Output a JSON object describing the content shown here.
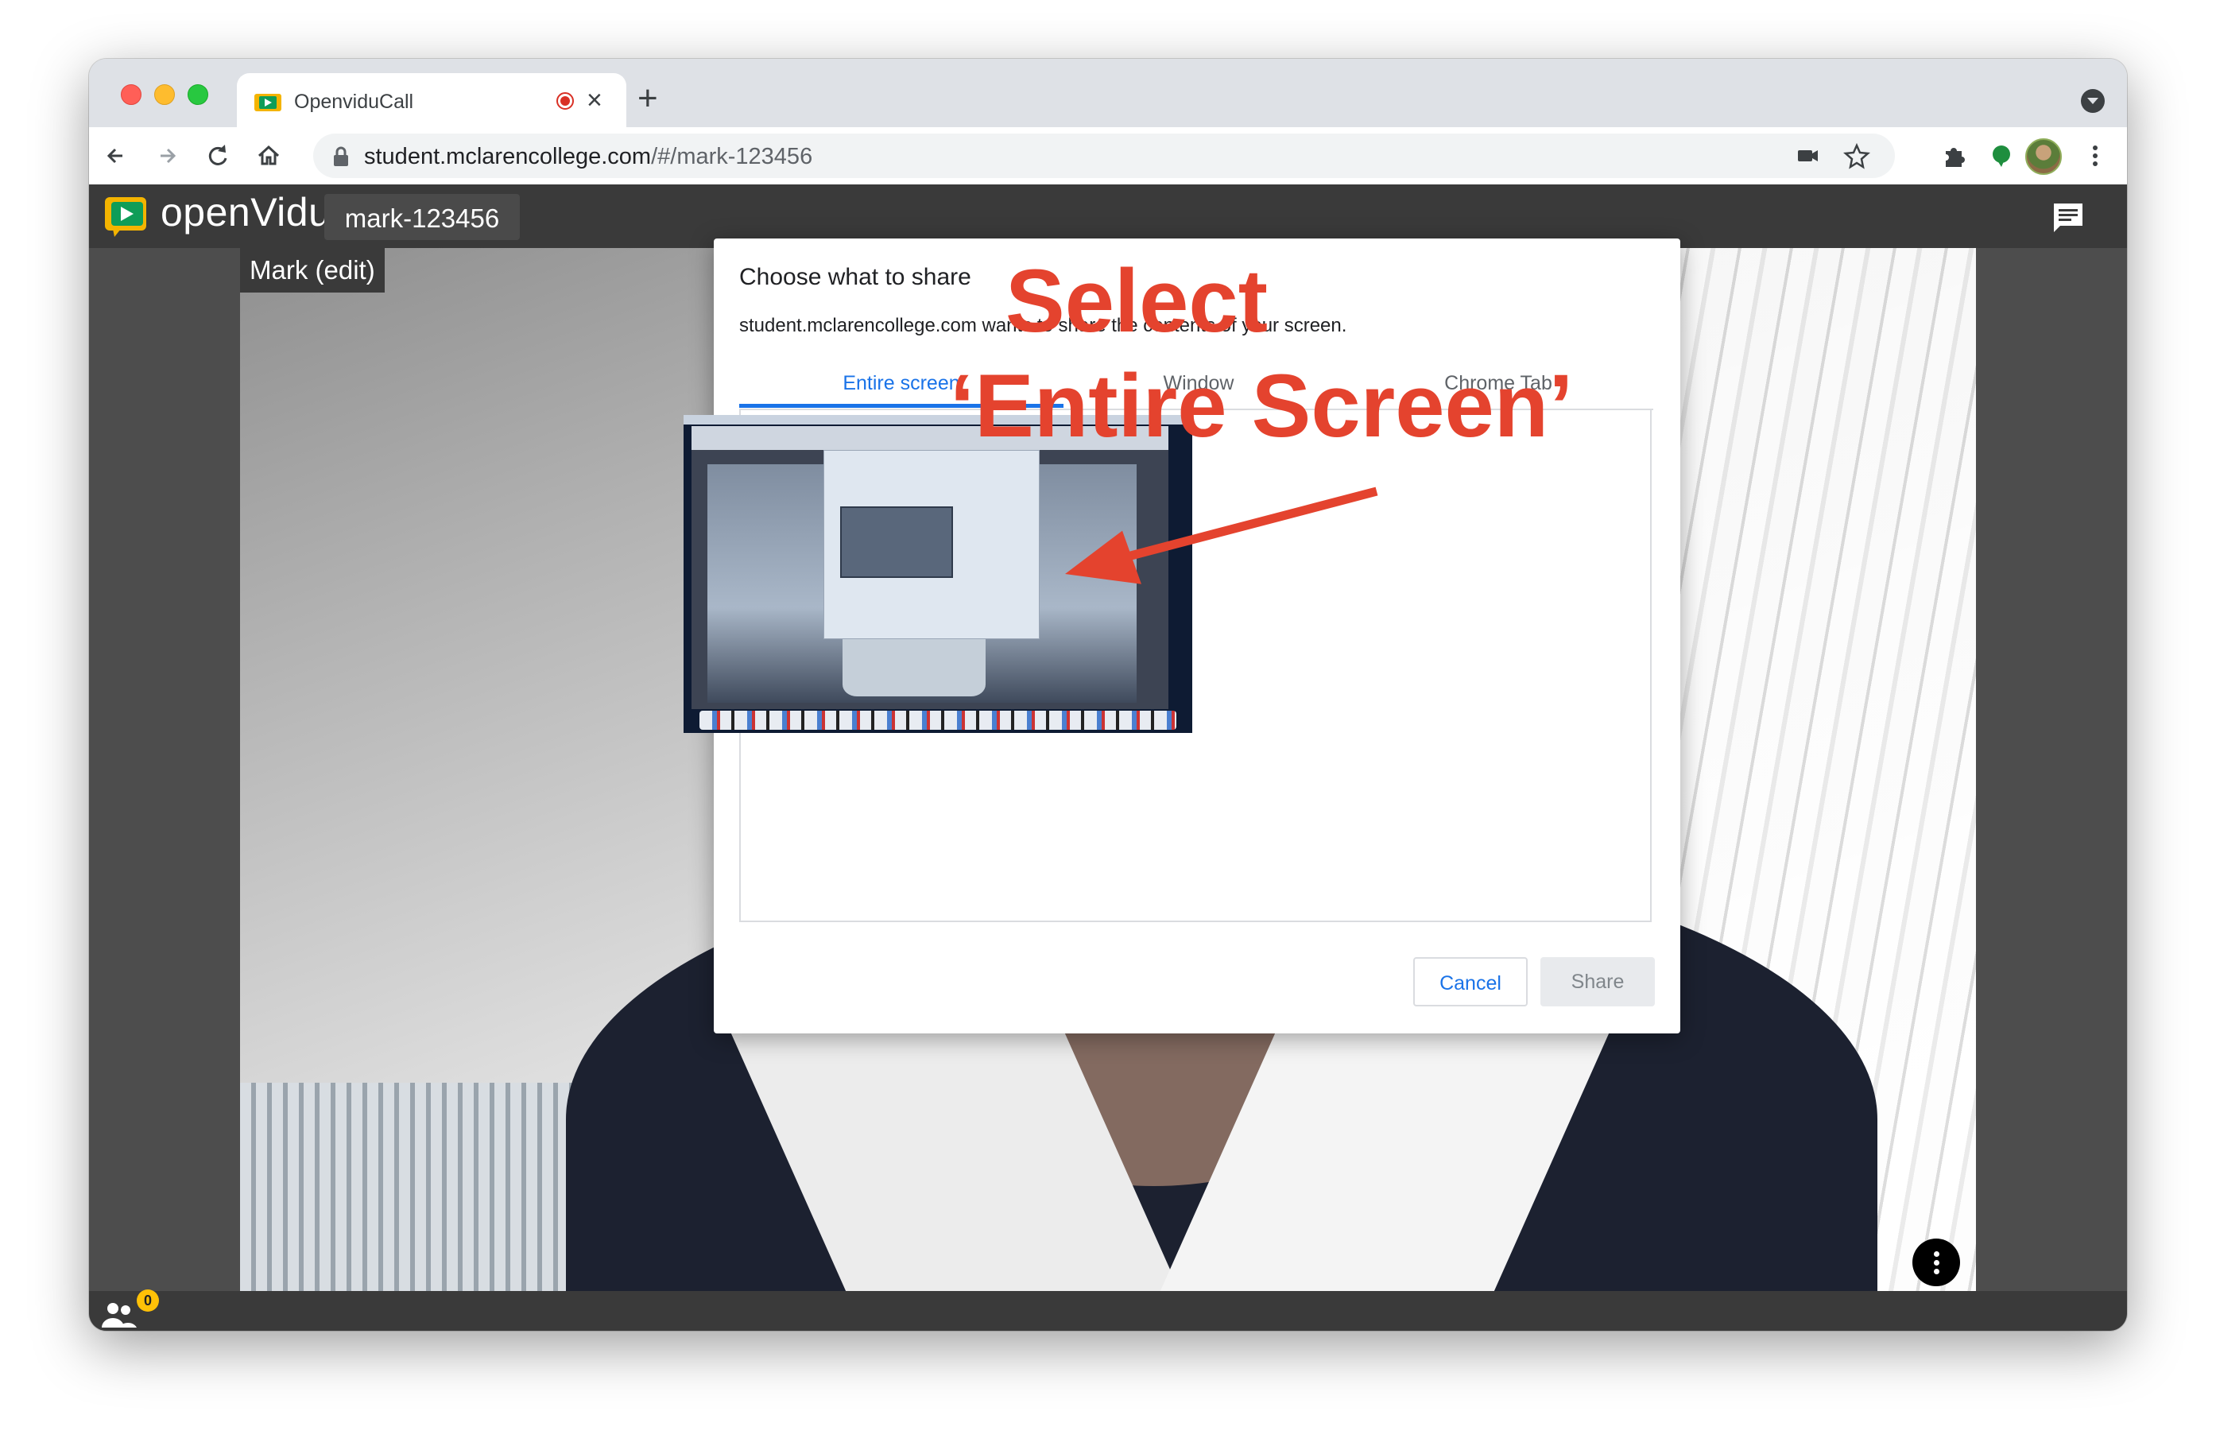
{
  "browser": {
    "tab_title": "OpenviduCall",
    "new_tab_symbol": "+",
    "close_symbol": "×",
    "url_host": "student.mclarencollege.com",
    "url_path": "/#/mark-123456"
  },
  "app": {
    "logo_text": "openVidu",
    "session_name": "mark-123456",
    "participant_label": "Mark (edit)",
    "participants_badge": "0"
  },
  "dialog": {
    "title": "Choose what to share",
    "subtitle": "student.mclarencollege.com wants to share the contents of your screen.",
    "tabs": [
      "Entire screen",
      "Window",
      "Chrome Tab"
    ],
    "active_tab": "Entire screen",
    "cancel_label": "Cancel",
    "share_label": "Share"
  },
  "annotation": {
    "line1": "Select",
    "line2": "‘Entire Screen’",
    "color": "#e4432e"
  },
  "colors": {
    "accent": "#1a73e8",
    "app_bar": "#3a3a3a",
    "badge": "#ffc107"
  }
}
